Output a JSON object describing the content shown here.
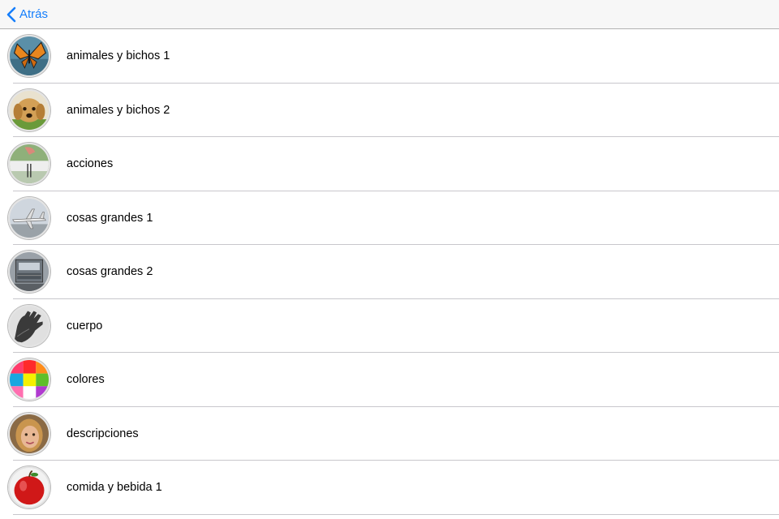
{
  "navbar": {
    "back_label": "Atrás",
    "accent_color": "#157efb"
  },
  "list": {
    "items": [
      {
        "label": "animales y bichos 1",
        "icon": "butterfly-icon"
      },
      {
        "label": "animales y bichos 2",
        "icon": "puppy-icon"
      },
      {
        "label": "acciones",
        "icon": "action-icon"
      },
      {
        "label": "cosas grandes 1",
        "icon": "airplane-icon"
      },
      {
        "label": "cosas grandes 2",
        "icon": "truck-icon"
      },
      {
        "label": "cuerpo",
        "icon": "hand-icon"
      },
      {
        "label": "colores",
        "icon": "color-grid-icon"
      },
      {
        "label": "descripciones",
        "icon": "woman-face-icon"
      },
      {
        "label": "comida y bebida 1",
        "icon": "apple-icon"
      }
    ]
  }
}
